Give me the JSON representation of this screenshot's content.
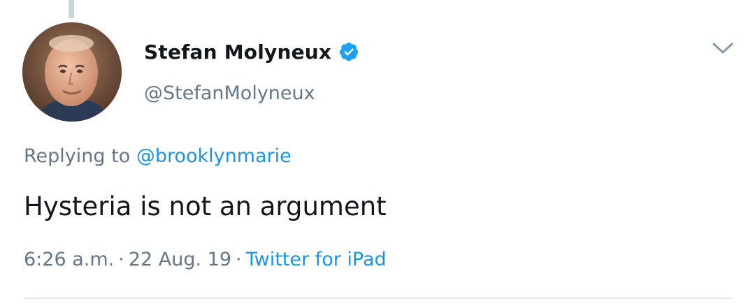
{
  "tweet": {
    "author": {
      "display_name": "Stefan Molyneux",
      "handle": "@StefanMolyneux",
      "verified": true,
      "avatar_icon": "avatar-photo"
    },
    "reply_context": {
      "prefix": "Replying to ",
      "mention": "@brooklynmarie"
    },
    "text": "Hysteria is not an argument",
    "meta": {
      "time": "6:26 a.m.",
      "separator": "·",
      "date": "22 Aug. 19",
      "source": "Twitter for iPad"
    },
    "menu_icon": "chevron-down-icon"
  },
  "colors": {
    "text_primary": "#14171a",
    "text_secondary": "#657786",
    "link": "#1b95e0",
    "verified_badge": "#1da1f2",
    "thread_line": "#c9d3da",
    "divider": "#e1e8ed"
  }
}
